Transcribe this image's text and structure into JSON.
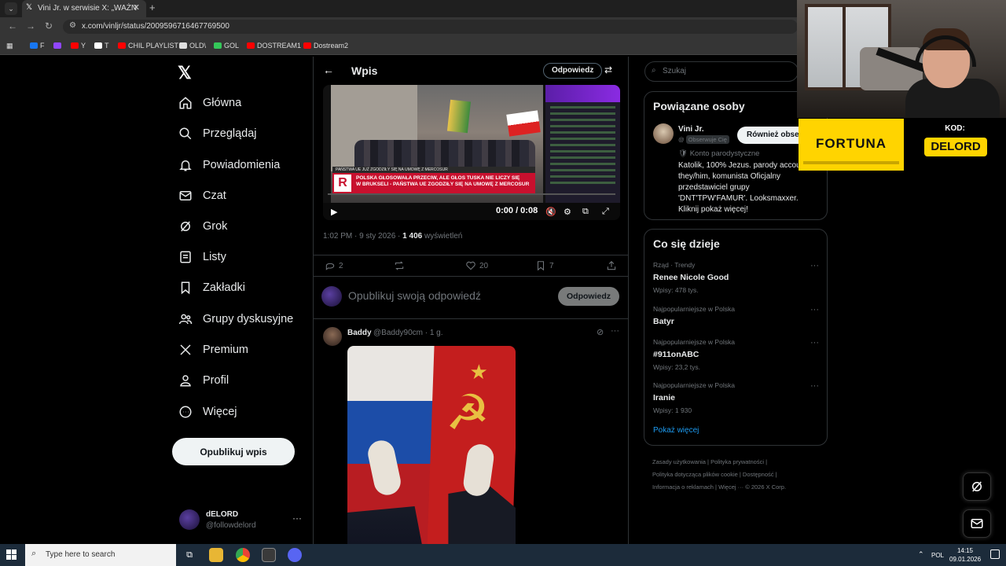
{
  "browser": {
    "tab_title": "Vini Jr. w serwisie X: „WAŻN",
    "url": "x.com/vinljr/status/2009596716467769500",
    "bookmarks": [
      {
        "label": "F",
        "color": "#1877f2"
      },
      {
        "label": "",
        "color": "#9146ff"
      },
      {
        "label": "Y",
        "color": "#ff0000"
      },
      {
        "label": "T",
        "color": "#ffffff"
      },
      {
        "label": "CHIL PLAYLIST",
        "color": "#ff0000"
      },
      {
        "label": "OLD\\",
        "color": "#e0e0e0"
      },
      {
        "label": "GOL",
        "color": "#34c759"
      },
      {
        "label": "DOSTREAM1",
        "color": "#ff0000"
      },
      {
        "label": "Dostream2",
        "color": "#ff0000"
      }
    ]
  },
  "sidebar": {
    "items": [
      {
        "label": "Główna",
        "icon": "home-icon"
      },
      {
        "label": "Przeglądaj",
        "icon": "search-icon"
      },
      {
        "label": "Powiadomienia",
        "icon": "bell-icon"
      },
      {
        "label": "Czat",
        "icon": "mail-icon"
      },
      {
        "label": "Grok",
        "icon": "grok-icon"
      },
      {
        "label": "Listy",
        "icon": "list-icon"
      },
      {
        "label": "Zakładki",
        "icon": "bookmark-icon"
      },
      {
        "label": "Grupy dyskusyjne",
        "icon": "people-icon"
      },
      {
        "label": "Premium",
        "icon": "x-icon"
      },
      {
        "label": "Profil",
        "icon": "person-icon"
      },
      {
        "label": "Więcej",
        "icon": "more-circle-icon"
      }
    ],
    "post_button": "Opublikuj wpis",
    "account": {
      "name": "dELORD",
      "handle": "@followdelord"
    }
  },
  "main": {
    "title": "Wpis",
    "reply_top": "Odpowiedz",
    "video": {
      "time": "0:00 / 0:08",
      "banner_top": "PAŃSTWA UE JUŻ ZGODZIŁY SIĘ NA UMOWĘ Z MERCOSUR",
      "banner_line1": "POLSKA GŁOSOWAŁA PRZECIW, ALE GŁOS TUSKA NIE LICZY SIĘ",
      "banner_line2": "W BRUKSELI - PAŃSTWA UE ZGODZIŁY SIĘ NA UMOWĘ Z MERCOSUR"
    },
    "meta": {
      "time": "1:02 PM · 9 sty 2026 · ",
      "views": "1 406",
      "views_label": " wyświetleń"
    },
    "stats": {
      "replies": "2",
      "reposts": "",
      "likes": "20",
      "bookmarks": "7"
    },
    "reply_placeholder": "Opublikuj swoją odpowiedź",
    "reply_button": "Odpowiedz",
    "reply_tweet": {
      "name": "Baddy",
      "handle": "@Baddy90cm · 1 g."
    }
  },
  "right": {
    "search_placeholder": "Szukaj",
    "related": {
      "title": "Powiązane osoby",
      "name": "Vini Jr.",
      "follows_you": "Obserwuje Cię",
      "follow_button": "Również obserwuj",
      "parody": "Konto parodystyczne",
      "bio": "Katolik, 100% Jezus. parody account. they/him, komunista Oficjalny przedstawiciel grupy 'DNT'TPW'FAMUR'. Looksmaxxer. Kliknij pokaż więcej!"
    },
    "trends": {
      "title": "Co się dzieje",
      "items": [
        {
          "category": "Rząd · Trendy",
          "name": "Renee Nicole Good",
          "count": "Wpisy: 478 tys."
        },
        {
          "category": "Najpopularniejsze w Polska",
          "name": "Batyr",
          "count": ""
        },
        {
          "category": "Najpopularniejsze w Polska",
          "name": "#911onABC",
          "count": "Wpisy: 23,2 tys."
        },
        {
          "category": "Najpopularniejsze w Polska",
          "name": "Iranie",
          "count": "Wpisy: 1 930"
        }
      ],
      "show_more": "Pokaż więcej"
    },
    "footer": {
      "line1": "Zasady użytkowania  |  Polityka prywatności  |",
      "line2": "Polityka dotycząca plików cookie  |  Dostępność  |",
      "line3": "Informacja o reklamach  |  Więcej ···  © 2026 X Corp."
    }
  },
  "overlay": {
    "brand": "FORTUNA",
    "code_label": "KOD:",
    "code": "DELORD"
  },
  "taskbar": {
    "search_placeholder": "Type here to search",
    "lang": "POL",
    "time": "14:15",
    "date": "09.01.2026"
  }
}
